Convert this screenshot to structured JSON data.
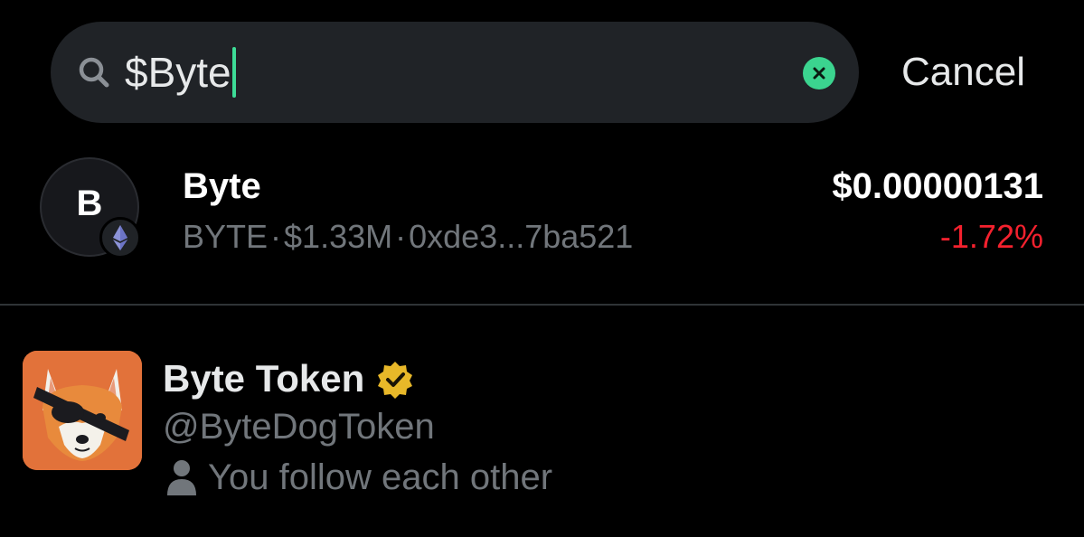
{
  "search": {
    "query": "$Byte",
    "cancel_label": "Cancel",
    "accent_color": "#3ddc97"
  },
  "token_result": {
    "avatar_letter": "B",
    "chain_icon": "ethereum-icon",
    "name": "Byte",
    "symbol": "BYTE",
    "separator": "·",
    "market_cap": "$1.33M",
    "address": "0xde3...7ba521",
    "price": "$0.00000131",
    "change": "-1.72%",
    "change_color": "#f4212e"
  },
  "account_result": {
    "avatar_icon": "fox-with-eyepatch-avatar",
    "name": "Byte Token",
    "verified_icon": "gold-verified-badge-icon",
    "verified_color": "#e8b829",
    "handle": "@ByteDogToken",
    "follow_status": "You follow each other"
  }
}
